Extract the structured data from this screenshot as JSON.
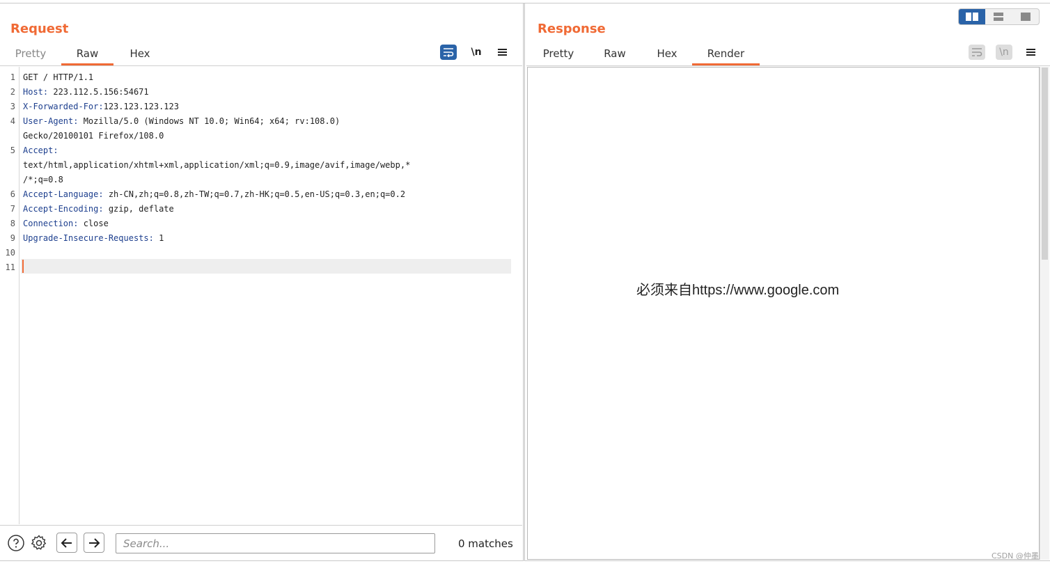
{
  "request": {
    "title": "Request",
    "tabs": [
      {
        "label": "Pretty",
        "active": false
      },
      {
        "label": "Raw",
        "active": true
      },
      {
        "label": "Hex",
        "active": false
      }
    ],
    "tools": {
      "wrap_icon": "wrap-lines-icon",
      "newline_label": "\\n",
      "menu_icon": "hamburger-menu-icon"
    },
    "lines": [
      {
        "num": "1",
        "key": "",
        "value": "GET / HTTP/1.1"
      },
      {
        "num": "2",
        "key": "Host:",
        "value": " 223.112.5.156:54671"
      },
      {
        "num": "3",
        "key": "X-Forwarded-For:",
        "value": "123.123.123.123"
      },
      {
        "num": "4",
        "key": "User-Agent:",
        "value": " Mozilla/5.0 (Windows NT 10.0; Win64; x64; rv:108.0)"
      },
      {
        "num": "",
        "key": "",
        "value": "Gecko/20100101 Firefox/108.0"
      },
      {
        "num": "5",
        "key": "Accept:",
        "value": ""
      },
      {
        "num": "",
        "key": "",
        "value": "text/html,application/xhtml+xml,application/xml;q=0.9,image/avif,image/webp,*"
      },
      {
        "num": "",
        "key": "",
        "value": "/*;q=0.8"
      },
      {
        "num": "6",
        "key": "Accept-Language:",
        "value": " zh-CN,zh;q=0.8,zh-TW;q=0.7,zh-HK;q=0.5,en-US;q=0.3,en;q=0.2"
      },
      {
        "num": "7",
        "key": "Accept-Encoding:",
        "value": " gzip, deflate"
      },
      {
        "num": "8",
        "key": "Connection:",
        "value": " close"
      },
      {
        "num": "9",
        "key": "Upgrade-Insecure-Requests:",
        "value": " 1"
      },
      {
        "num": "10",
        "key": "",
        "value": ""
      },
      {
        "num": "11",
        "key": "",
        "value": ""
      }
    ],
    "search": {
      "placeholder": "Search...",
      "matches": "0 matches"
    }
  },
  "response": {
    "title": "Response",
    "tabs": [
      {
        "label": "Pretty",
        "active": false
      },
      {
        "label": "Raw",
        "active": false
      },
      {
        "label": "Hex",
        "active": false
      },
      {
        "label": "Render",
        "active": true
      }
    ],
    "tools": {
      "wrap_icon": "wrap-lines-icon",
      "newline_label": "\\n",
      "menu_icon": "hamburger-menu-icon"
    },
    "render_text": "必须来自https://www.google.com"
  },
  "layout_toggles": [
    {
      "icon": "side-by-side-layout-icon",
      "active": true
    },
    {
      "icon": "top-bottom-layout-icon",
      "active": false
    },
    {
      "icon": "single-pane-layout-icon",
      "active": false
    }
  ],
  "watermark": "CSDN @仲墨",
  "colors": {
    "accent": "#f06a35",
    "active_blue": "#2a63a8",
    "header_key": "#1d3f8e"
  }
}
